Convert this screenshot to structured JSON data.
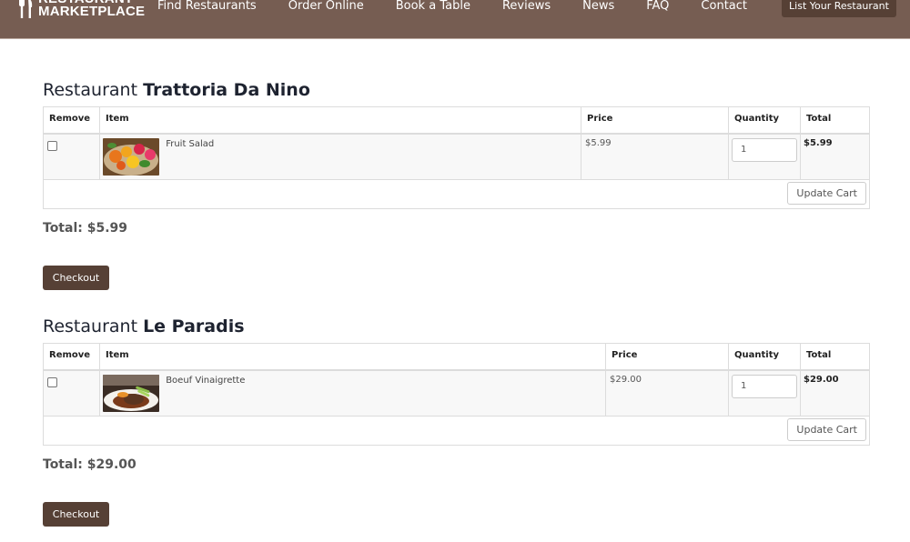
{
  "header": {
    "logo_line1": "RESTAURANT",
    "logo_line2": "MARKETPLACE",
    "nav": [
      "Find Restaurants",
      "Order Online",
      "Book a Table",
      "Reviews",
      "News",
      "FAQ",
      "Contact"
    ],
    "cta_label": "List Your Restaurant",
    "colors": {
      "bar": "#765d52",
      "button": "#564035"
    }
  },
  "table_headers": {
    "remove": "Remove",
    "item": "Item",
    "price": "Price",
    "quantity": "Quantity",
    "total": "Total"
  },
  "carts": [
    {
      "prefix": "Restaurant",
      "restaurant": "Trattoria Da Nino",
      "items": [
        {
          "name": "Fruit Salad",
          "image": "fruit-salad-photo",
          "price": "$5.99",
          "quantity": "1",
          "total": "$5.99",
          "remove_checked": false
        }
      ],
      "update_label": "Update Cart",
      "grand_total": "Total: $5.99",
      "checkout_label": "Checkout"
    },
    {
      "prefix": "Restaurant",
      "restaurant": "Le Paradis",
      "items": [
        {
          "name": "Boeuf Vinaigrette",
          "image": "boeuf-vinaigrette-photo",
          "price": "$29.00",
          "quantity": "1",
          "total": "$29.00",
          "remove_checked": false
        }
      ],
      "update_label": "Update Cart",
      "grand_total": "Total: $29.00",
      "checkout_label": "Checkout"
    }
  ]
}
